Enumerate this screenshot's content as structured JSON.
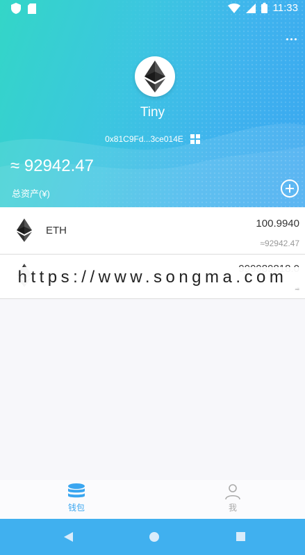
{
  "status_bar": {
    "time": "11:33"
  },
  "wallet": {
    "name": "Tiny",
    "address": "0x81C9Fd...3ce014E",
    "total_value": "≈ 92942.47",
    "total_label": "总资产(¥)"
  },
  "tokens": [
    {
      "symbol": "ETH",
      "balance": "100.9940",
      "fiat": "≈92942.47"
    },
    {
      "symbol": "",
      "balance": "999989818.0",
      "fiat": "≈"
    }
  ],
  "watermark": "https://www.songma.com",
  "tabs": [
    {
      "label": "钱包",
      "active": true
    },
    {
      "label": "我",
      "active": false
    }
  ],
  "colors": {
    "accent": "#3aa6f0",
    "header_start": "#33d6c7",
    "header_end": "#3aa6f0",
    "nav_bar": "#40b0ef"
  },
  "icons": {
    "header_menu": "more-icon",
    "address_qr": "qr-code-icon",
    "add_token": "add-circle-icon",
    "tab_wallet": "coin-stack-icon",
    "tab_me": "person-icon"
  }
}
